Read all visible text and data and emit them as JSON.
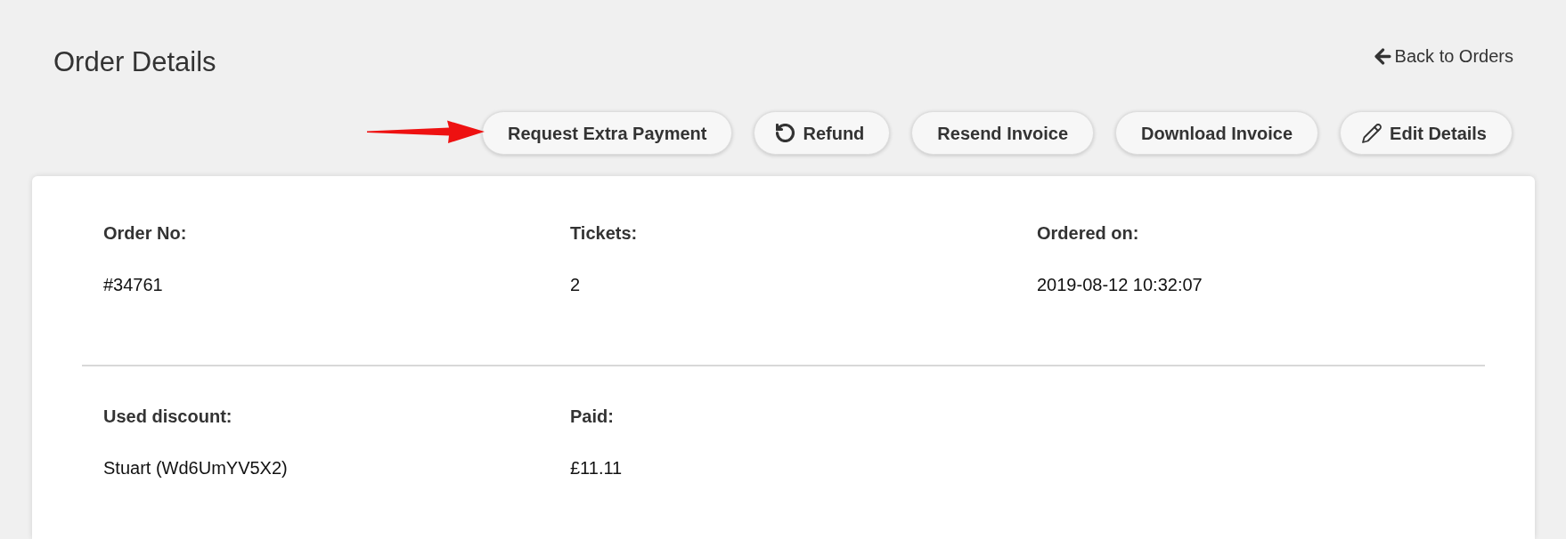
{
  "page": {
    "title": "Order Details",
    "back_link": {
      "label": "Back to Orders"
    }
  },
  "actions": [
    {
      "label": "Request Extra Payment",
      "kind": "plain"
    },
    {
      "label": "Refund",
      "kind": "undo"
    },
    {
      "label": "Resend Invoice",
      "kind": "plain"
    },
    {
      "label": "Download Invoice",
      "kind": "plain"
    },
    {
      "label": "Edit Details",
      "kind": "edit"
    }
  ],
  "sections": [
    {
      "fields": [
        {
          "label": "Order No:",
          "value": "#34761"
        },
        {
          "label": "Tickets:",
          "value": "2"
        },
        {
          "label": "Ordered on:",
          "value": "2019-08-12 10:32:07"
        }
      ]
    },
    {
      "fields": [
        {
          "label": "Used discount:",
          "value": "Stuart (Wd6UmYV5X2)"
        },
        {
          "label": "Paid:",
          "value": "£11.11"
        }
      ]
    }
  ]
}
